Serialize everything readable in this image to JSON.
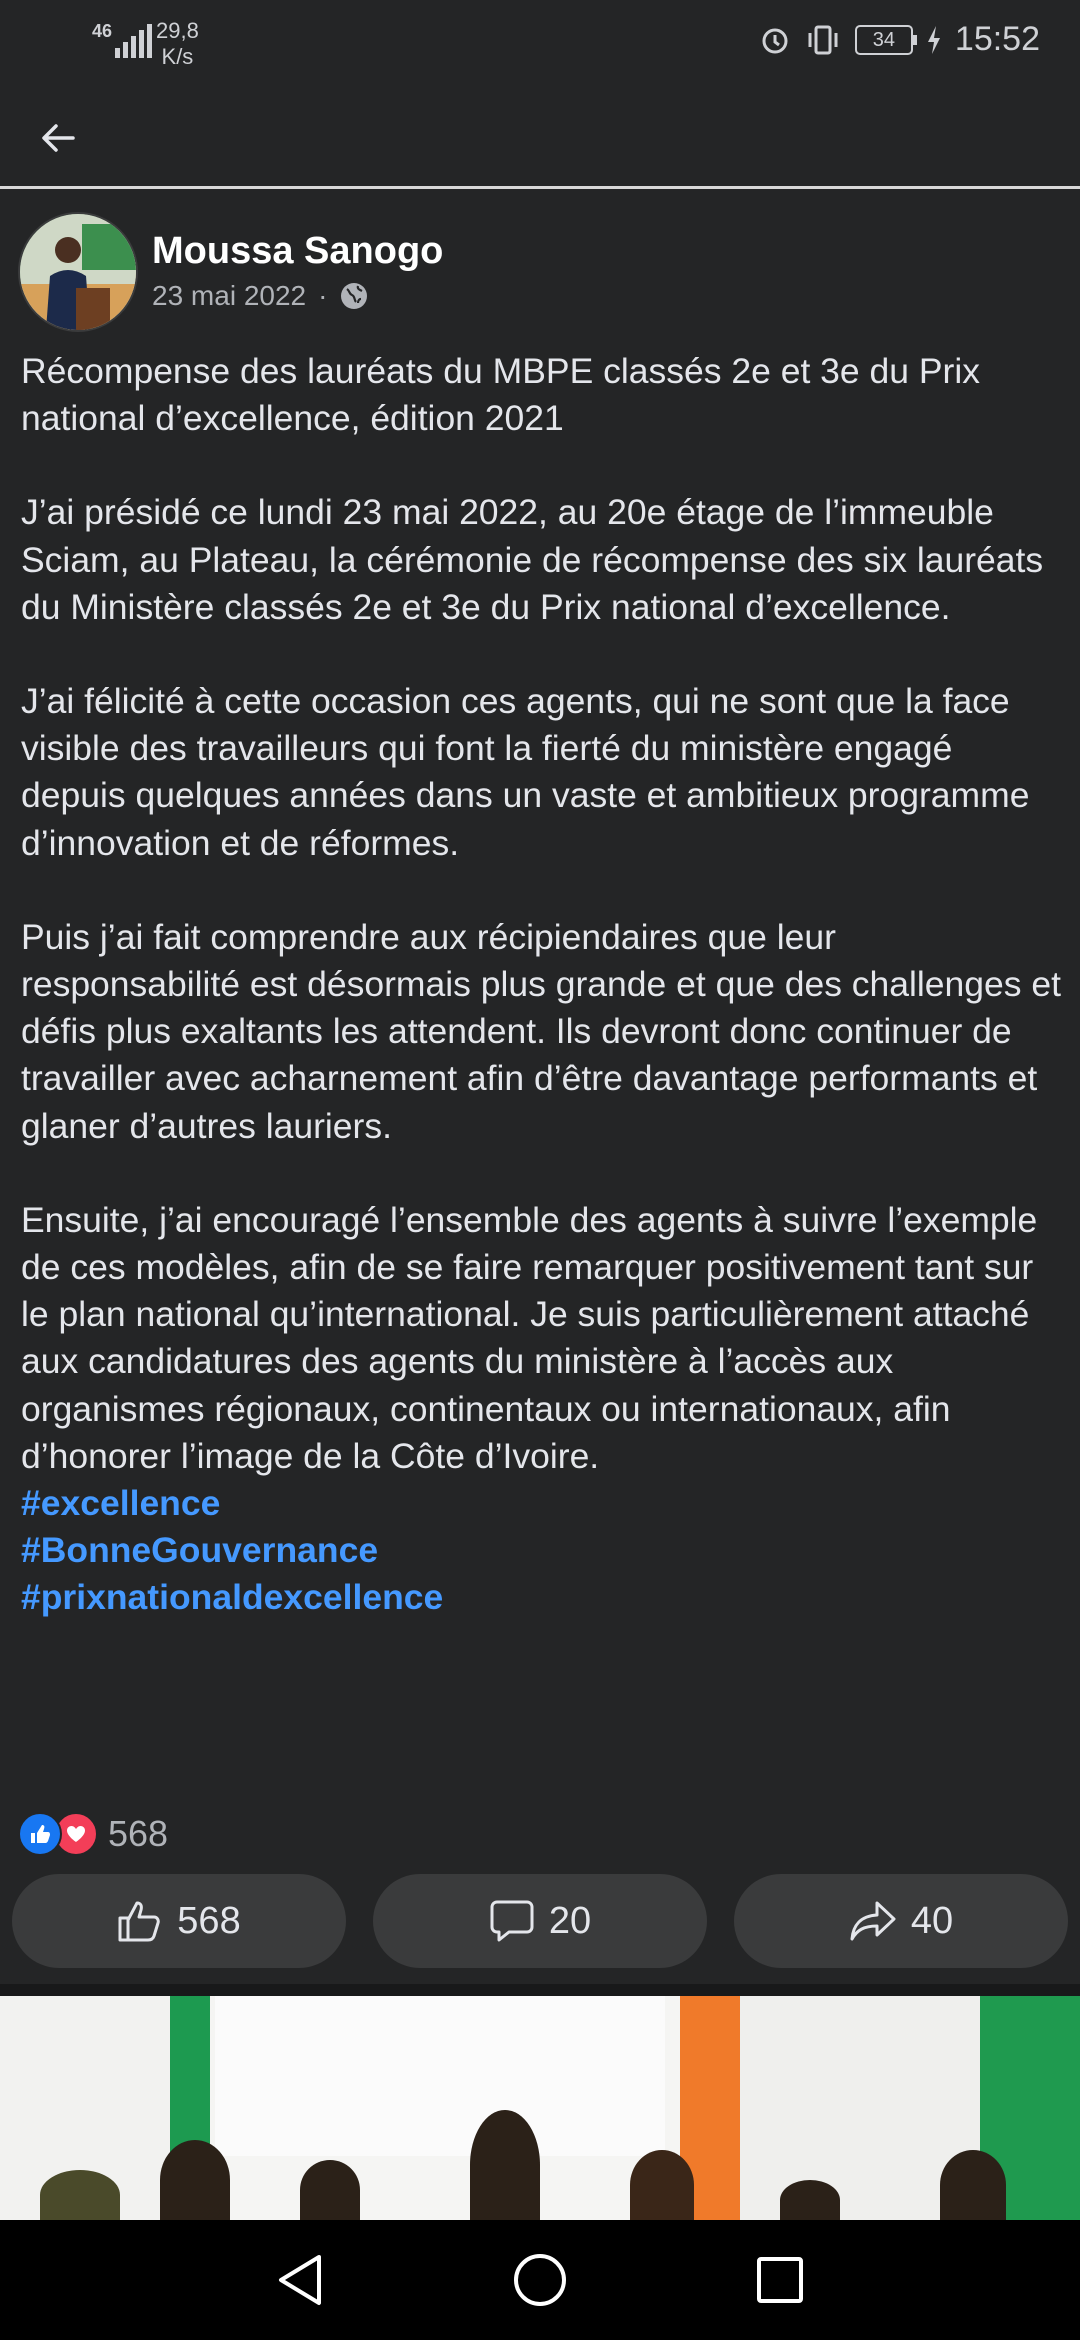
{
  "status": {
    "network": "46",
    "speed_value": "29,8",
    "speed_unit": "K/s",
    "battery": "34",
    "time": "15:52"
  },
  "post": {
    "author": "Moussa Sanogo",
    "date": "23 mai 2022",
    "separator": "·",
    "paragraphs": [
      "Récompense des lauréats du MBPE classés 2e et 3e du Prix national d’excellence, édition 2021",
      "J’ai présidé ce lundi 23 mai 2022, au 20e étage de l’immeuble Sciam, au Plateau, la cérémonie de récompense des six lauréats du Ministère classés 2e et 3e du Prix national d’excellence.",
      "J’ai félicité à cette occasion ces agents, qui ne sont que la face visible des travailleurs qui font la fierté du ministère engagé depuis quelques années dans un vaste et ambitieux programme d’innovation et de réformes.",
      "Puis j’ai fait comprendre aux récipiendaires que leur responsabilité est désormais plus grande et que des challenges et défis plus exaltants les attendent. Ils devront donc continuer de travailler avec acharnement afin d’être davantage performants et glaner d’autres lauriers.",
      "Ensuite, j’ai encouragé l’ensemble des agents à suivre l’exemple de ces modèles, afin de se faire remarquer positivement tant sur le plan national qu’international. Je suis particulièrement attaché aux candidatures des agents du ministère à l’accès aux organismes régionaux, continentaux ou internationaux, afin d’honorer l’image de la Côte d’Ivoire."
    ],
    "hashtags": [
      "#excellence",
      "#BonneGouvernance",
      "#prixnationaldexcellence"
    ],
    "reaction_count": "568",
    "actions": {
      "like": "568",
      "comment": "20",
      "share": "40"
    }
  },
  "colors": {
    "background": "#242526",
    "hashtag": "#4599ff",
    "button": "#3a3b3c",
    "like": "#1877f2",
    "love": "#f33e58"
  },
  "icons": [
    "back-arrow-icon",
    "globe-icon",
    "like-icon",
    "love-icon",
    "thumbs-up-icon",
    "comment-icon",
    "share-icon",
    "nav-back-icon",
    "nav-home-icon",
    "nav-recents-icon"
  ]
}
